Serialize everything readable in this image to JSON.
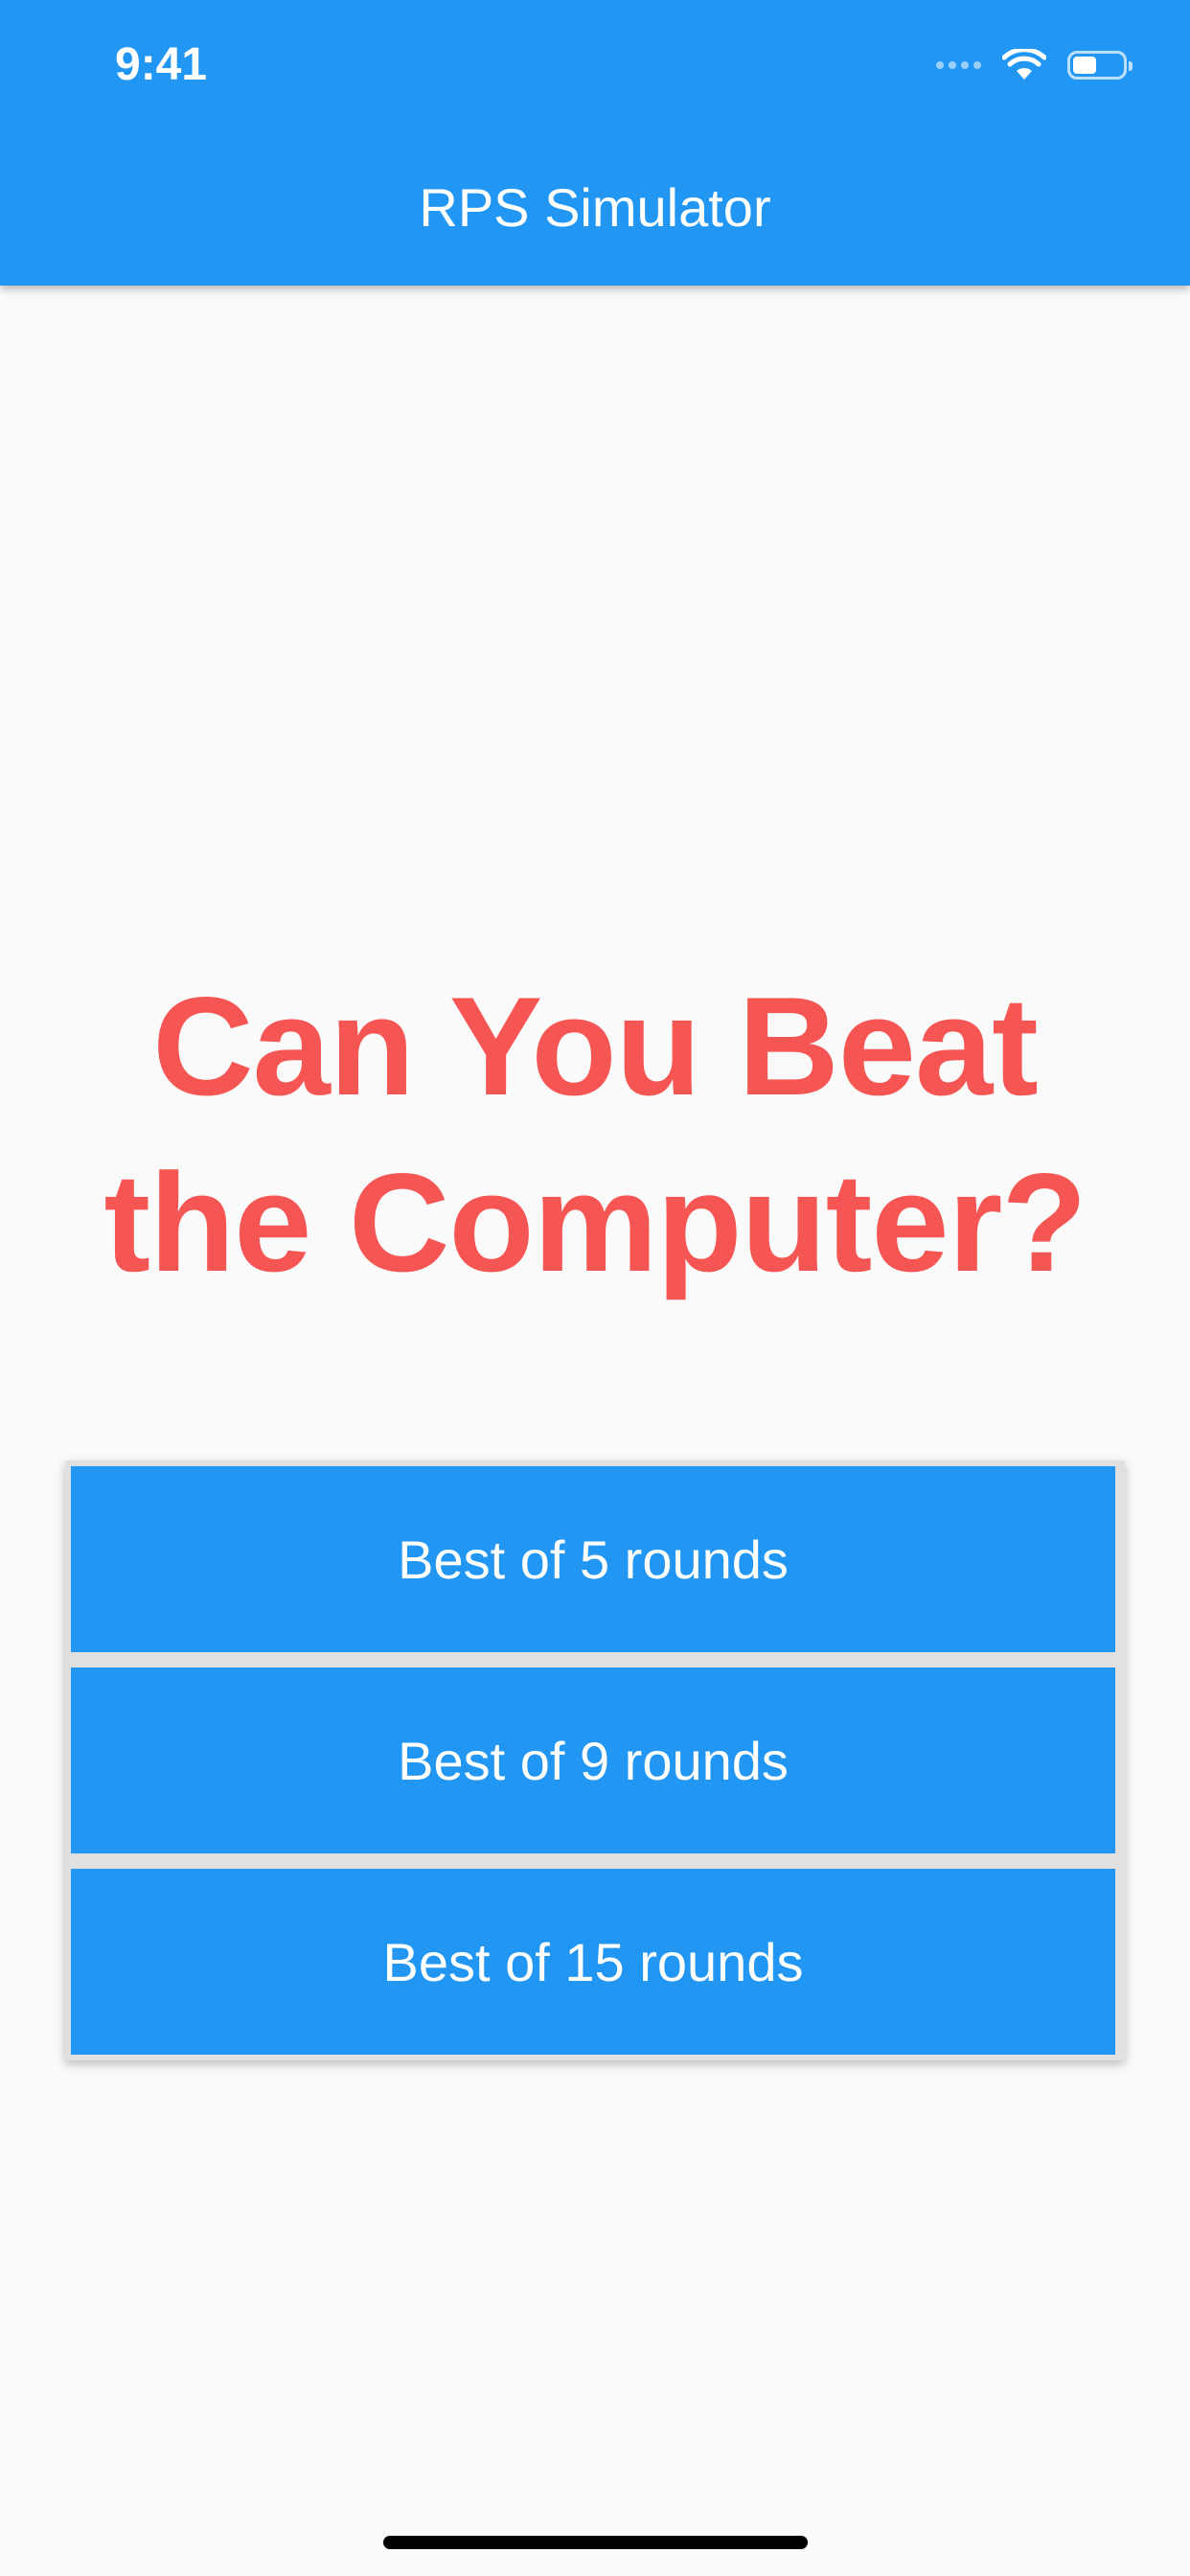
{
  "status_bar": {
    "time": "9:41",
    "icons": [
      "signal-dots-icon",
      "wifi-icon",
      "battery-icon"
    ]
  },
  "app_bar": {
    "title": "RPS Simulator",
    "color": "#2196f3"
  },
  "main": {
    "headline_line1": "Can You Beat",
    "headline_line2": "the Computer?",
    "headline_color": "#f55553",
    "buttons": [
      {
        "label": "Best of 5 rounds"
      },
      {
        "label": "Best of 9 rounds"
      },
      {
        "label": "Best of 15 rounds"
      }
    ]
  }
}
